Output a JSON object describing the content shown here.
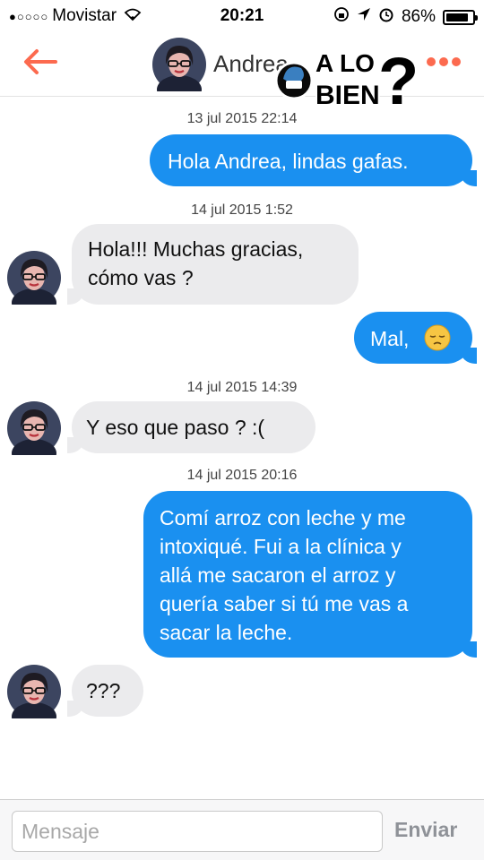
{
  "status_bar": {
    "carrier": "Movistar",
    "time": "20:21",
    "battery_percent": "86%",
    "battery_level": 0.86
  },
  "header": {
    "contact_name": "Andrea",
    "back_icon": "back-arrow-icon",
    "menu_icon": "more-dots-icon",
    "accent_color": "#fc6a4f"
  },
  "watermark": {
    "line1": "A LO",
    "line2": "BIEN",
    "mark": "?"
  },
  "messages": [
    {
      "timestamp": "13 jul 2015 22:14",
      "from": "me",
      "text": "Hola Andrea, lindas gafas."
    },
    {
      "timestamp": "14 jul 2015 1:52",
      "from": "andrea",
      "lines": [
        "Hola!!! Muchas gracias,",
        "cómo vas ?"
      ]
    },
    {
      "from": "me",
      "text": "Mal,",
      "emoji": "pensive-face-icon"
    },
    {
      "timestamp": "14 jul 2015 14:39",
      "from": "andrea",
      "text": "Y eso que paso ? :("
    },
    {
      "timestamp": "14 jul 2015 20:16",
      "from": "me",
      "lines": [
        "Comí arroz con leche y me",
        "intoxiqué. Fui a la clínica y",
        "allá me sacaron el arroz y",
        "quería saber si tú me vas a",
        "sacar la leche."
      ]
    },
    {
      "from": "andrea",
      "text": "???"
    }
  ],
  "composer": {
    "placeholder": "Mensaje",
    "send_label": "Enviar"
  },
  "colors": {
    "outgoing_bubble": "#1a90f0",
    "incoming_bubble": "#ebebed"
  }
}
